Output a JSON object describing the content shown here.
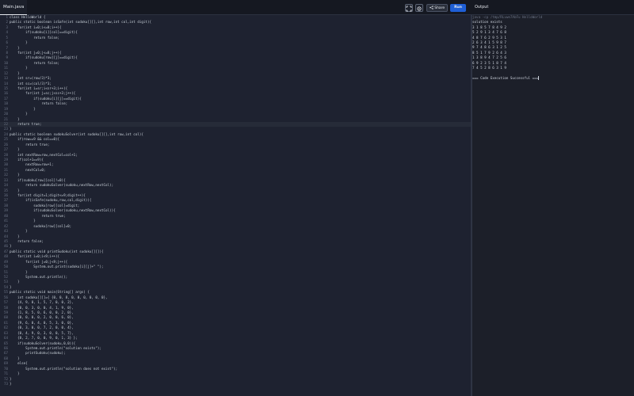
{
  "header": {
    "tab_label": "Main.java",
    "share_label": "Share",
    "run_label": "Run",
    "output_title": "Output",
    "icons": [
      "fullscreen-icon",
      "settings-icon",
      "share-icon"
    ]
  },
  "code_lines": [
    "class HelloWorld {",
    "public static boolean isSafe(int sudoku[][],int row,int col,int digit){",
    "    for(int i=0;i<=8;i++){",
    "        if(sudoku[i][col]==digit){",
    "            return false;",
    "        }",
    "    }",
    "    for(int j=0;j<=8;j++){",
    "        if(sudoku[row][j]==digit){",
    "            return false;",
    "        }",
    "    }",
    "    int sr=(row/3)*3;",
    "    int sc=(col/3)*3;",
    "    for(int i=sr;i<sr+3;i++){",
    "        for(int j=sc;j<sc+3;j++){",
    "            if(sudoku[i][j]==digit){",
    "                return false;",
    "            }",
    "        }",
    "    }",
    "    return true;",
    "}",
    "public static boolean sudokuSolver(int sudoku[][],int row,int col){",
    "    if(row==9 && col==0){",
    "        return true;",
    "    }",
    "    int nextRow=row,nextCol=col+1;",
    "    if(col+1==9){",
    "        nextRow=row+1;",
    "        nextCol=0;",
    "    }",
    "    if(sudoku[row][col]!=0){",
    "        return sudokuSolver(sudoku,nextRow,nextCol);",
    "    }",
    "    for(int digit=1;digit<=9;digit++){",
    "        if(isSafe(sudoku,row,col,digit)){",
    "            sudoku[row][col]=digit;",
    "            if(sudokuSolver(sudoku,nextRow,nextCol)){",
    "                return true;",
    "            }",
    "            sudoku[row][col]=0;",
    "        }",
    "    }",
    "    return false;",
    "}",
    "public static void printSudoku(int sudoku[][]){",
    "    for(int i=0;i<9;i++){",
    "        for(int j=0;j<9;j++){",
    "            System.out.print(sudoku[i][j]+\" \");",
    "        }",
    "        System.out.println();",
    "    }",
    "}",
    "public static void main(String[] args) {",
    "    int sudoku[][]={ {0, 0, 8, 0, 0, 0, 0, 0, 0},",
    "    {4, 9, 0, 1, 5, 7, 0, 0, 2},",
    "    {0, 0, 3, 0, 0, 4, 1, 9, 0},",
    "    {1, 8, 5, 0, 6, 0, 0, 2, 0},",
    "    {0, 0, 0, 0, 2, 0, 0, 6, 0},",
    "    {9, 6, 0, 4, 0, 5, 3, 0, 0},",
    "    {0, 3, 0, 0, 7, 2, 0, 0, 4},",
    "    {0, 4, 9, 0, 3, 0, 0, 5, 7},",
    "    {8, 2, 7, 0, 0, 9, 0, 1, 3} };",
    "    if(sudokuSolver(sudoku,0,0)){",
    "        System.out.println(\"solution exists\");",
    "        printSudoku(sudoku);",
    "    }",
    "    else{",
    "        System.out.println(\"solution does not exist\");",
    "    }",
    "}",
    "}"
  ],
  "active_line": 22,
  "output_lines": [
    "java -cp /tmp/RLvwe7AbFu HelloWorld",
    "solution exists",
    "3 1 8 5 7 8 4 9 2",
    "5 2 9 1 3 4 7 6 8",
    "4 8 7 6 2 9 5 3 1",
    "2 6 3 4 1 5 9 8 7",
    "9 7 4 8 6 3 1 2 5",
    "8 5 1 7 9 2 6 4 3",
    "1 3 8 9 4 7 2 5 6",
    "6 9 2 3 5 1 8 7 4",
    "7 4 5 2 8 6 3 1 9",
    "",
    "=== Code Execution Successful ==="
  ]
}
